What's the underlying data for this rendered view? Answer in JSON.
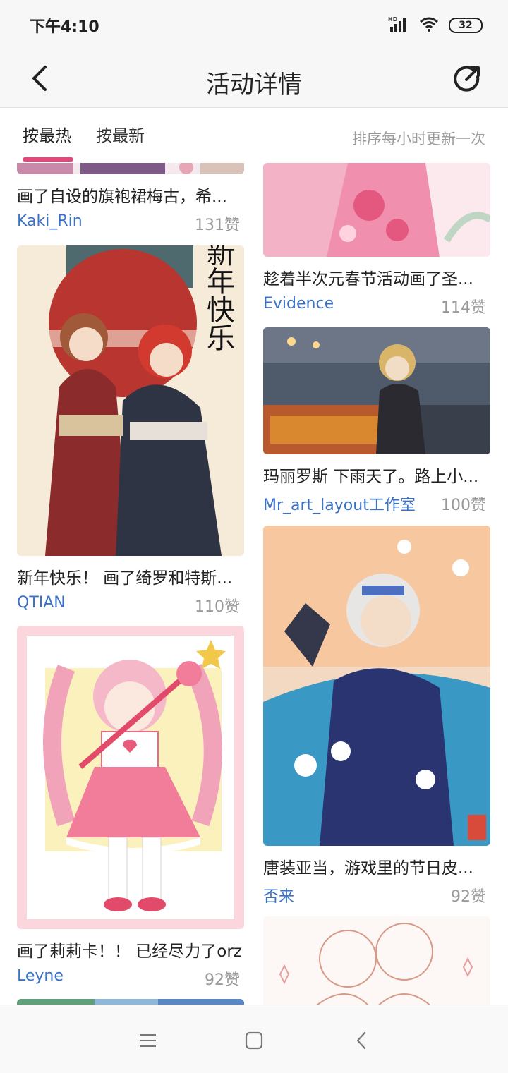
{
  "status": {
    "time": "下午4:10",
    "network": "HD",
    "battery": "32"
  },
  "header": {
    "title": "活动详情"
  },
  "tabs": {
    "hot": "按最热",
    "newest": "按最新",
    "sort_note": "排序每小时更新一次"
  },
  "cards": {
    "c1": {
      "caption": "画了自设的旗袍裙梅古，希...",
      "author": "Kaki_Rin",
      "likes": "131赞"
    },
    "c2": {
      "caption": "新年快乐！ 画了绮罗和特斯...",
      "author": "QTIAN",
      "likes": "110赞"
    },
    "c3": {
      "caption": "画了莉莉卡！！ 已经尽力了orz",
      "author": "Leyne",
      "likes": "92赞"
    },
    "c4": {
      "caption": "趁着半次元春节活动画了圣...",
      "author": "Evidence",
      "likes": "114赞"
    },
    "c5": {
      "caption": "玛丽罗斯 下雨天了。路上小...",
      "author": "Mr_art_layout工作室",
      "likes": "100赞"
    },
    "c6": {
      "caption": "唐装亚当，游戏里的节日皮...",
      "author": "否来",
      "likes": "92赞"
    }
  },
  "artwork_text": {
    "new_year_calligraphy": "新年快乐"
  },
  "icons": {
    "back": "chevron-left-icon",
    "share": "share-external-icon",
    "signal": "signal-icon",
    "wifi": "wifi-icon",
    "battery": "battery-icon",
    "menu": "menu-icon",
    "home": "home-square-icon",
    "nav_back": "nav-back-icon"
  },
  "colors": {
    "accent": "#e8457b",
    "author_link": "#3b72c7",
    "muted": "#999999"
  }
}
